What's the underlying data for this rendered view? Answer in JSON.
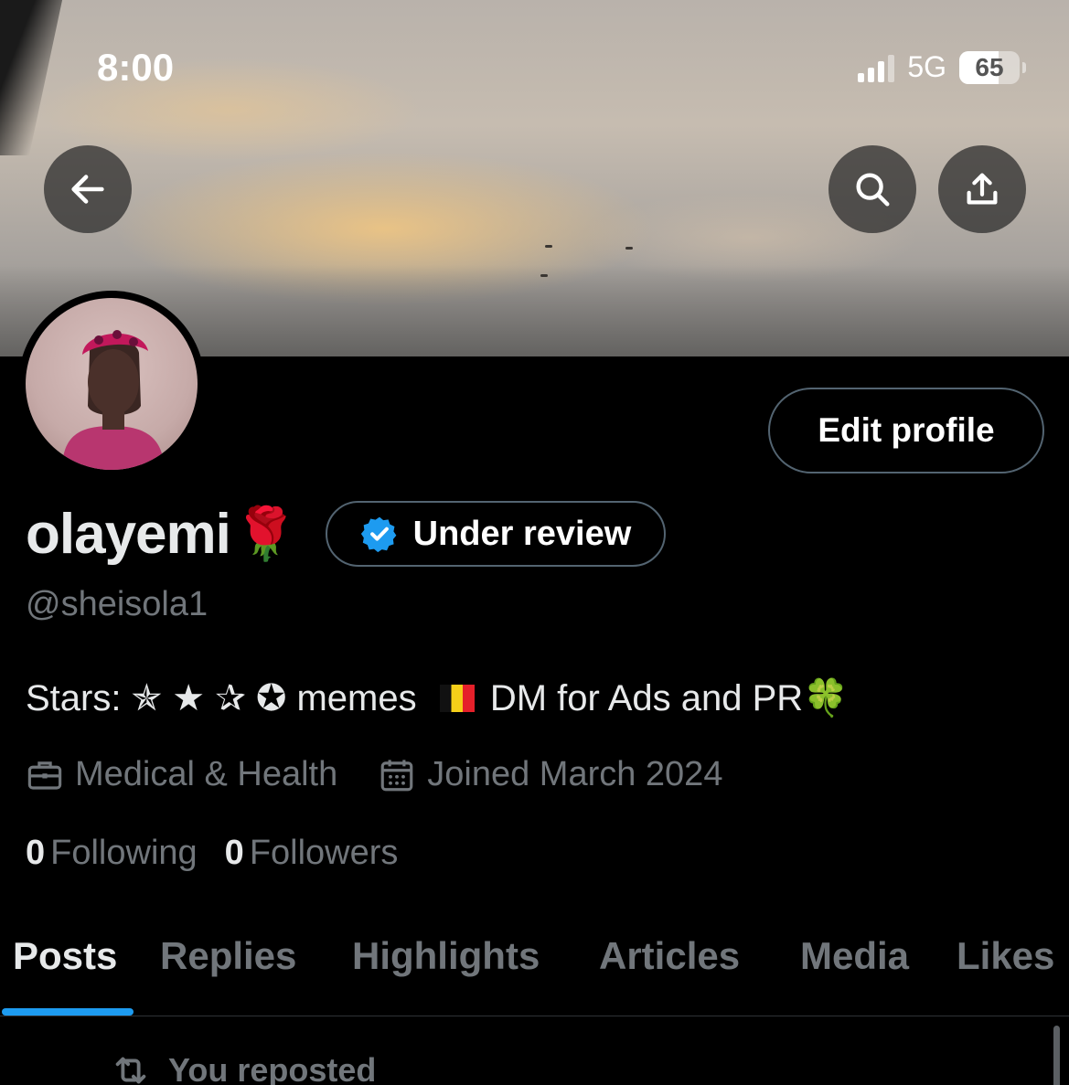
{
  "status_bar": {
    "time": "8:00",
    "network": "5G",
    "battery": "65"
  },
  "header": {
    "back_icon": "arrow-left-icon",
    "search_icon": "search-icon",
    "share_icon": "share-upload-icon"
  },
  "profile": {
    "edit_label": "Edit profile",
    "display_name": "olayemi",
    "name_emoji": "🌹",
    "badge_label": "Under review",
    "handle": "@sheisola1",
    "bio_text": "Stars: ✯ ★ ✰ ✪ memes",
    "bio_tail": "DM for Ads and PR",
    "bio_emoji": "🍀",
    "category": "Medical & Health",
    "joined": "Joined March 2024",
    "following_count": "0",
    "following_label": "Following",
    "followers_count": "0",
    "followers_label": "Followers"
  },
  "tabs": [
    {
      "label": "Posts",
      "active": true
    },
    {
      "label": "Replies"
    },
    {
      "label": "Highlights"
    },
    {
      "label": "Articles"
    },
    {
      "label": "Media"
    },
    {
      "label": "Likes"
    }
  ],
  "feed": {
    "repost_label": "You reposted"
  },
  "colors": {
    "accent": "#1d9bf0",
    "muted": "#71767b",
    "border": "#536471",
    "background": "#000000"
  }
}
